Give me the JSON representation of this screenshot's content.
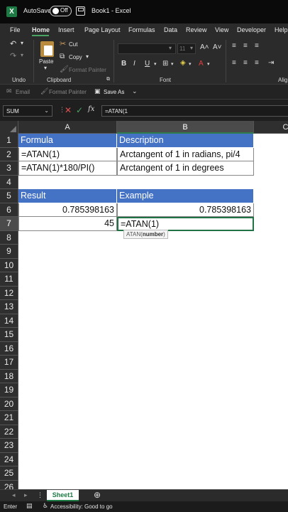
{
  "titlebar": {
    "autosave_label": "AutoSave",
    "autosave_state": "Off",
    "document_title": "Book1 - Excel"
  },
  "ribbon_tabs": [
    "File",
    "Home",
    "Insert",
    "Page Layout",
    "Formulas",
    "Data",
    "Review",
    "View",
    "Developer",
    "Help"
  ],
  "active_tab": "Home",
  "ribbon": {
    "undo_group": "Undo",
    "paste_label": "Paste",
    "cut_label": "Cut",
    "copy_label": "Copy",
    "format_painter_label": "Format Painter",
    "clipboard_group": "Clipboard",
    "font_size": "11",
    "font_group": "Font",
    "alignment_group": "Alig"
  },
  "quick_access": {
    "email_label": "Email",
    "format_painter_label": "Format Painter",
    "save_as_label": "Save As"
  },
  "formula_bar": {
    "name_box": "SUM",
    "fx_label": "fx",
    "formula": "=ATAN(1"
  },
  "columns": [
    "A",
    "B",
    "C"
  ],
  "rows": [
    "1",
    "2",
    "3",
    "4",
    "5",
    "6",
    "7",
    "8",
    "9",
    "10",
    "11",
    "12",
    "13",
    "14",
    "15",
    "16",
    "17",
    "18",
    "19",
    "20",
    "21",
    "22",
    "23",
    "24",
    "25",
    "26"
  ],
  "cells": {
    "a1": "Formula",
    "b1": "Description",
    "a2": "=ATAN(1)",
    "b2": "Arctangent of 1 in radians, pi/4",
    "a3": "=ATAN(1)*180/PI()",
    "b3": "Arctangent of 1 in degrees",
    "a5": "Result",
    "b5": "Example",
    "a6": "0.785398163",
    "b6": "0.785398163",
    "a7": "45",
    "b7": "=ATAN(1)"
  },
  "tooltip": {
    "fn": "ATAN(",
    "arg": "number",
    "close": ")"
  },
  "sheet_tab": "Sheet1",
  "status": {
    "mode": "Enter",
    "accessibility": "Accessibility: Good to go"
  }
}
